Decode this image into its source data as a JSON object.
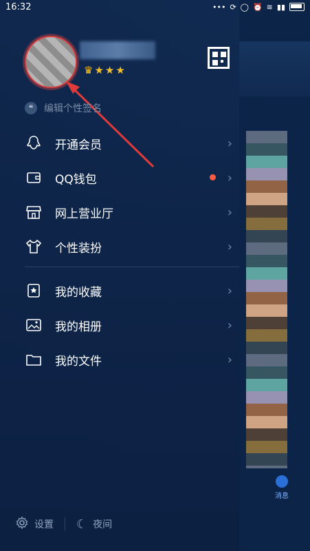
{
  "status_bar": {
    "time": "16:32"
  },
  "profile": {
    "signature_placeholder": "编辑个性签名"
  },
  "menu_section_1": [
    {
      "label": "开通会员",
      "icon": "penguin-icon",
      "has_dot": false
    },
    {
      "label": "QQ钱包",
      "icon": "wallet-icon",
      "has_dot": true
    },
    {
      "label": "网上营业厅",
      "icon": "store-icon",
      "has_dot": false
    },
    {
      "label": "个性装扮",
      "icon": "shirt-icon",
      "has_dot": false
    }
  ],
  "menu_section_2": [
    {
      "label": "我的收藏",
      "icon": "favorite-icon"
    },
    {
      "label": "我的相册",
      "icon": "album-icon"
    },
    {
      "label": "我的文件",
      "icon": "folder-icon"
    }
  ],
  "bottom_bar": {
    "settings_label": "设置",
    "night_label": "夜间"
  },
  "right_panel": {
    "tab_label": "消息"
  },
  "colors": {
    "accent_red": "#ff5a43",
    "highlight_ring": "#d84040",
    "background": "#0e2748"
  }
}
